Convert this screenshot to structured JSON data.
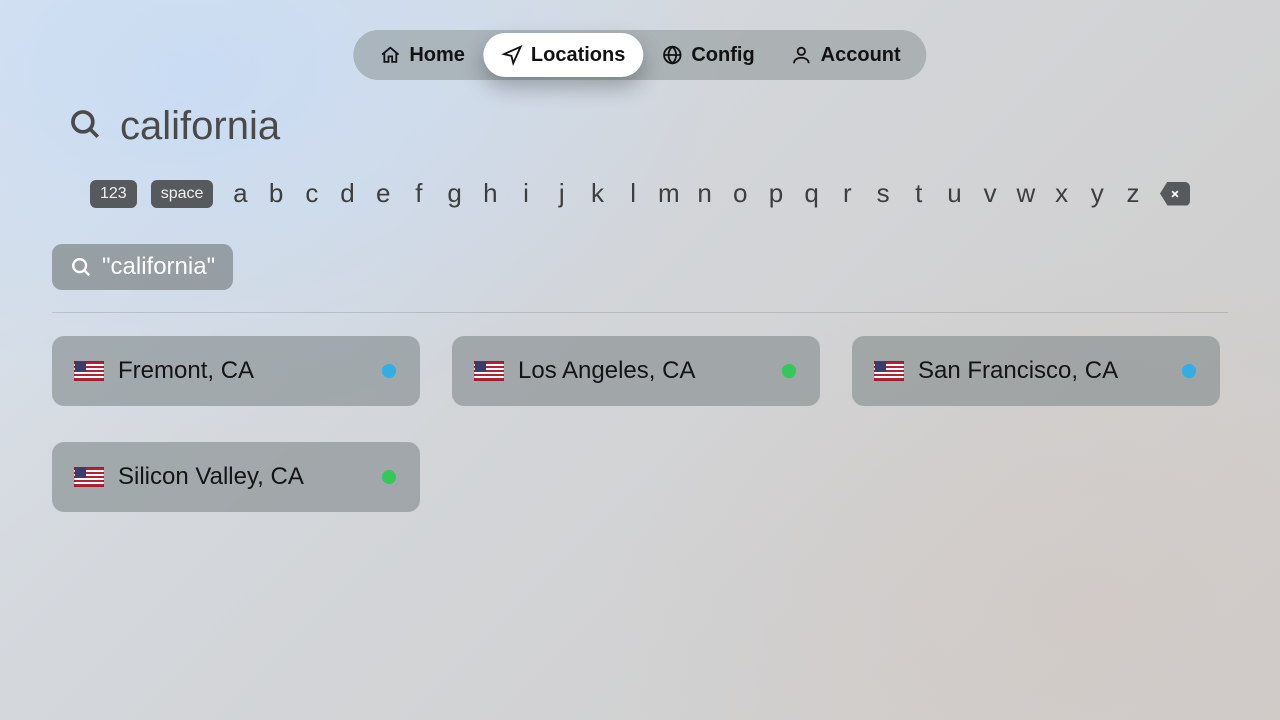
{
  "nav": {
    "items": [
      {
        "id": "home",
        "label": "Home",
        "icon": "home-icon",
        "active": false
      },
      {
        "id": "locations",
        "label": "Locations",
        "icon": "navigate-icon",
        "active": true
      },
      {
        "id": "config",
        "label": "Config",
        "icon": "globe-icon",
        "active": false
      },
      {
        "id": "account",
        "label": "Account",
        "icon": "user-icon",
        "active": false
      }
    ]
  },
  "search": {
    "query": "california"
  },
  "keyboard": {
    "mode_key": "123",
    "space_key": "space",
    "letters": [
      "a",
      "b",
      "c",
      "d",
      "e",
      "f",
      "g",
      "h",
      "i",
      "j",
      "k",
      "l",
      "m",
      "n",
      "o",
      "p",
      "q",
      "r",
      "s",
      "t",
      "u",
      "v",
      "w",
      "x",
      "y",
      "z"
    ]
  },
  "suggestion": {
    "text": "\"california\""
  },
  "status_colors": {
    "blue": "#32ade6",
    "green": "#34c759"
  },
  "results": [
    {
      "flag": "us",
      "label": "Fremont, CA",
      "status": "blue"
    },
    {
      "flag": "us",
      "label": "Los Angeles, CA",
      "status": "green"
    },
    {
      "flag": "us",
      "label": "San Francisco, CA",
      "status": "blue"
    },
    {
      "flag": "us",
      "label": "Silicon Valley, CA",
      "status": "green"
    }
  ]
}
